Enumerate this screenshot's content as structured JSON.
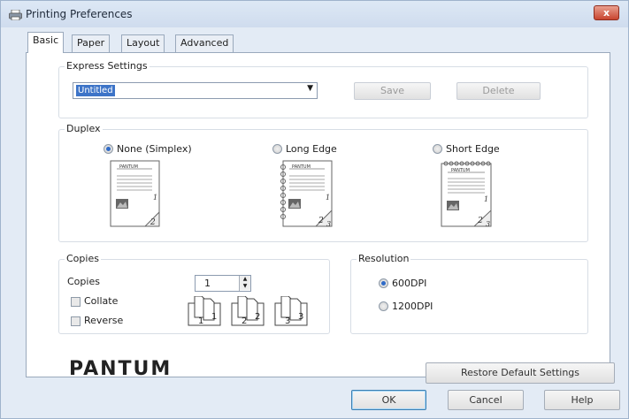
{
  "window": {
    "title": "Printing Preferences",
    "close_label": "x"
  },
  "tabs": [
    {
      "label": "Basic",
      "active": true
    },
    {
      "label": "Paper",
      "active": false
    },
    {
      "label": "Layout",
      "active": false
    },
    {
      "label": "Advanced",
      "active": false
    }
  ],
  "express": {
    "label": "Express Settings",
    "selected": "Untitled",
    "save_label": "Save",
    "delete_label": "Delete"
  },
  "duplex": {
    "label": "Duplex",
    "options": [
      {
        "label": "None (Simplex)",
        "selected": true
      },
      {
        "label": "Long Edge",
        "selected": false
      },
      {
        "label": "Short Edge",
        "selected": false
      }
    ],
    "preview_brand": "PANTUM"
  },
  "copies": {
    "label": "Copies",
    "field_label": "Copies",
    "value": "1",
    "collate_label": "Collate",
    "reverse_label": "Reverse",
    "collate_pages": [
      "1",
      "2",
      "3"
    ]
  },
  "resolution": {
    "label": "Resolution",
    "options": [
      {
        "label": "600DPI",
        "selected": true
      },
      {
        "label": "1200DPI",
        "selected": false
      }
    ]
  },
  "brand_logo": "PANTUM",
  "buttons": {
    "restore_label": "Restore Default Settings",
    "ok_label": "OK",
    "cancel_label": "Cancel",
    "help_label": "Help"
  },
  "colors": {
    "accent": "#2f6bc8",
    "title_bg": "#d6e2f1",
    "close": "#c8452f"
  }
}
